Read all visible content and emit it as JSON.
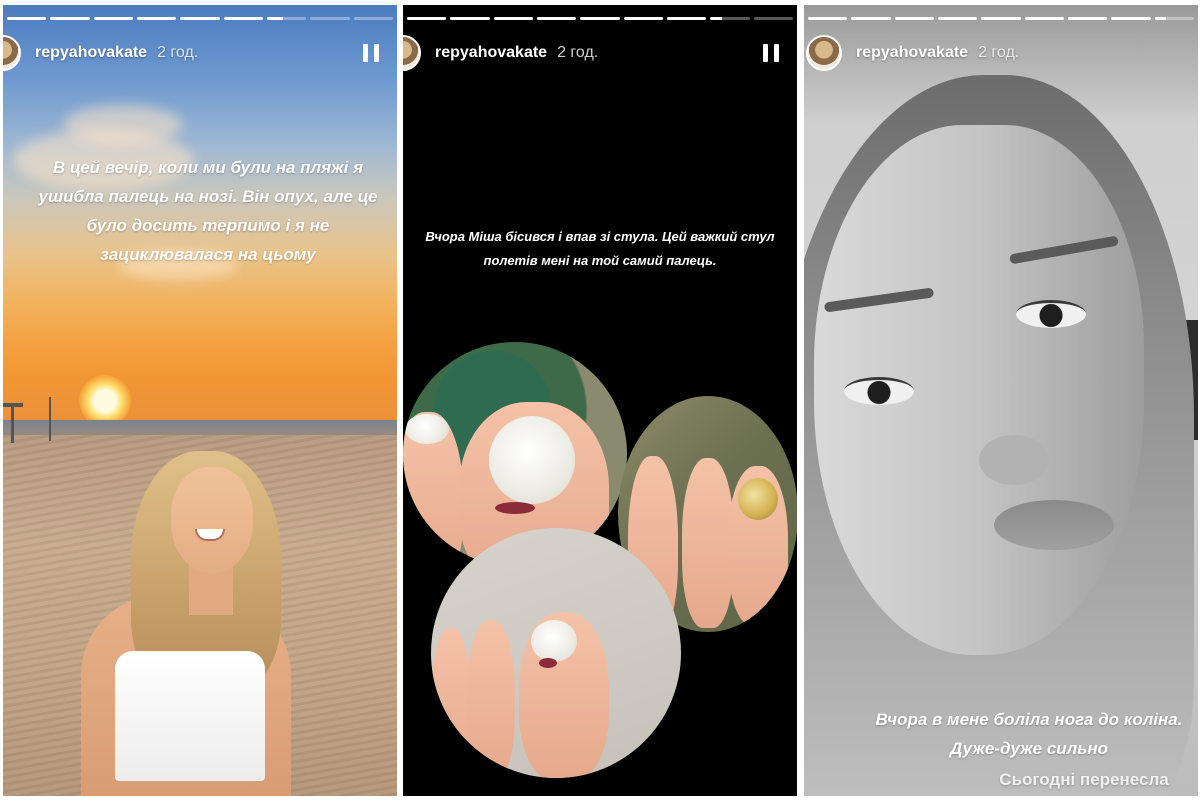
{
  "stories": [
    {
      "username": "repyahovakate",
      "time": "2 год.",
      "caption": "В цей вечір, коли ми були на пляжі я ушибла палець на нозі. Він опух, але це було досить терпимо і я не зациклювалася на цьому",
      "progress": [
        1,
        1,
        1,
        1,
        1,
        1,
        0.4,
        0,
        0
      ]
    },
    {
      "username": "repyahovakate",
      "time": "2 год.",
      "caption": "Вчора Міша бісився і впав зі стула. Цей важкий стул полетів мені на той самий палець.",
      "progress": [
        1,
        1,
        1,
        1,
        1,
        1,
        1,
        0.3,
        0
      ]
    },
    {
      "username": "repyahovakate",
      "time": "2 год.",
      "caption": "Вчора в мене боліла нога до коліна. Дуже-дуже сильно",
      "caption_partial": "Сьогодні перенесла",
      "progress": [
        1,
        1,
        1,
        1,
        1,
        1,
        1,
        1,
        0.3
      ]
    }
  ],
  "icons": {
    "pause": "pause-icon"
  },
  "colors": {
    "progress_fill": "#ffffff",
    "progress_track": "rgba(255,255,255,0.35)"
  }
}
